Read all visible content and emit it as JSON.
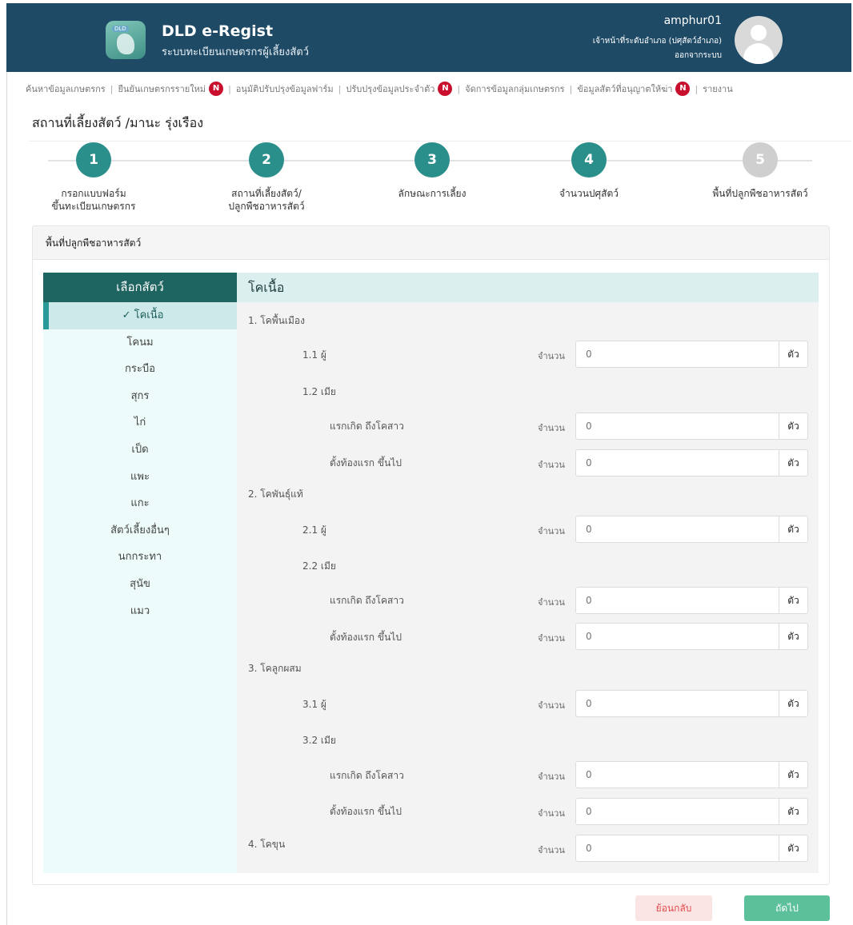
{
  "header": {
    "app_title": "DLD e-Regist",
    "app_subtitle": "ระบบทะเบียนเกษตรกรผู้เลี้ยงสัตว์",
    "logo_tag": "DLD",
    "user_name": "amphur01",
    "user_role": "เจ้าหน้าที่ระดับอำเภอ (ปศุสัตว์อำเภอ)",
    "user_action": "ออกจากระบบ",
    "header_color": "#1e4a66"
  },
  "nav": {
    "items": [
      {
        "label": "ค้นหาข้อมูลเกษตรกร",
        "badge": ""
      },
      {
        "label": "ยืนยันเกษตรกรรายใหม่",
        "badge": "N"
      },
      {
        "label": "อนุมัติปรับปรุงข้อมูลฟาร์ม",
        "badge": ""
      },
      {
        "label": "ปรับปรุงข้อมูลประจำตัว",
        "badge": "N"
      },
      {
        "label": "จัดการข้อมูลกลุ่มเกษตรกร",
        "badge": ""
      },
      {
        "label": "ข้อมูลสัตว์ที่อนุญาตให้ฆ่า",
        "badge": "N"
      },
      {
        "label": "รายงาน",
        "badge": ""
      }
    ],
    "separator": "|"
  },
  "page_title": "สถานที่เลี้ยงสัตว์ /มานะ รุ่งเรือง",
  "stepper": {
    "steps": [
      {
        "number": "1",
        "line1": "กรอกแบบฟอร์ม",
        "line2": "ขึ้นทะเบียนเกษตรกร",
        "state": "done"
      },
      {
        "number": "2",
        "line1": "สถานที่เลี้ยงสัตว์/",
        "line2": "ปลูกพืชอาหารสัตว์",
        "state": "done"
      },
      {
        "number": "3",
        "line1": "ลักษณะการเลี้ยง",
        "line2": "",
        "state": "done"
      },
      {
        "number": "4",
        "line1": "จำนวนปศุสัตว์",
        "line2": "",
        "state": "current"
      },
      {
        "number": "5",
        "line1": "พื้นที่ปลูกพืชอาหารสัตว์",
        "line2": "",
        "state": "inactive"
      }
    ]
  },
  "panel": {
    "title": "พื้นที่ปลูกพืชอาหารสัตว์"
  },
  "sidebar": {
    "title": "เลือกสัตว์",
    "items": [
      "✓ โคเนื้อ",
      "โคนม",
      "กระบือ",
      "สุกร",
      "ไก่",
      "เป็ด",
      "แพะ",
      "แกะ",
      "สัตว์เลี้ยงอื่นๆ",
      "นกกระทา",
      "สุนัข",
      "แมว"
    ],
    "active_index": 0
  },
  "content": {
    "title": "โคเนื้อ",
    "count_label": "จำนวน",
    "unit": "ตัว",
    "placeholder": "0",
    "categories": [
      {
        "label": "1. โคพื้นเมือง"
      },
      {
        "label": "2. โคพันธุ์แท้"
      },
      {
        "label": "3. โคลูกผสม"
      },
      {
        "label": "4. โคขุน"
      }
    ],
    "sub_labels": {
      "male_1": "1.1 ผู้",
      "female_1": "1.2 เมีย",
      "male_2": "2.1 ผู้",
      "female_2": "2.2 เมีย",
      "male_3": "3.1 ผู้",
      "female_3": "3.2 เมีย",
      "born_to_heifer": "แรกเกิด ถึงโคสาว",
      "first_pregnancy_up": "ตั้งท้องแรก ขึ้นไป"
    }
  },
  "footer": {
    "back_label": "ย้อนกลับ",
    "next_label": "ถัดไป"
  }
}
